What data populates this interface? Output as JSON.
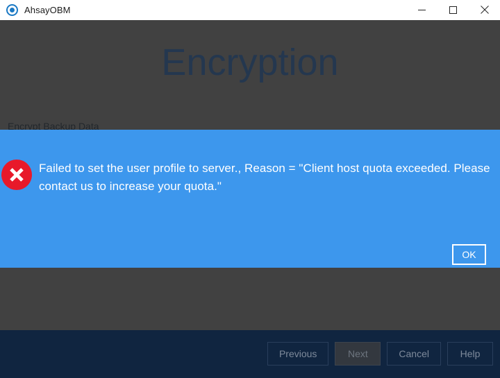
{
  "window": {
    "title": "AhsayOBM",
    "app_icon": "target-icon",
    "controls": {
      "minimize": "minimize-icon",
      "maximize": "maximize-icon",
      "close": "close-icon"
    }
  },
  "page": {
    "heading": "Encryption",
    "section_label": "Encrypt Backup Data",
    "heading_color": "#24374f",
    "background_color": "#414141"
  },
  "dialog": {
    "type": "error",
    "icon": "error-circle-x-icon",
    "icon_color": "#e8192a",
    "background_color": "#3d97ed",
    "message": "Failed to set the user profile to server., Reason = \"Client host quota exceeded. Please contact us to increase your quota.\"",
    "ok_label": "OK"
  },
  "footer": {
    "background_color": "#102540",
    "buttons": [
      {
        "label": "Previous",
        "disabled": false
      },
      {
        "label": "Next",
        "disabled": true
      },
      {
        "label": "Cancel",
        "disabled": false
      },
      {
        "label": "Help",
        "disabled": false
      }
    ]
  }
}
